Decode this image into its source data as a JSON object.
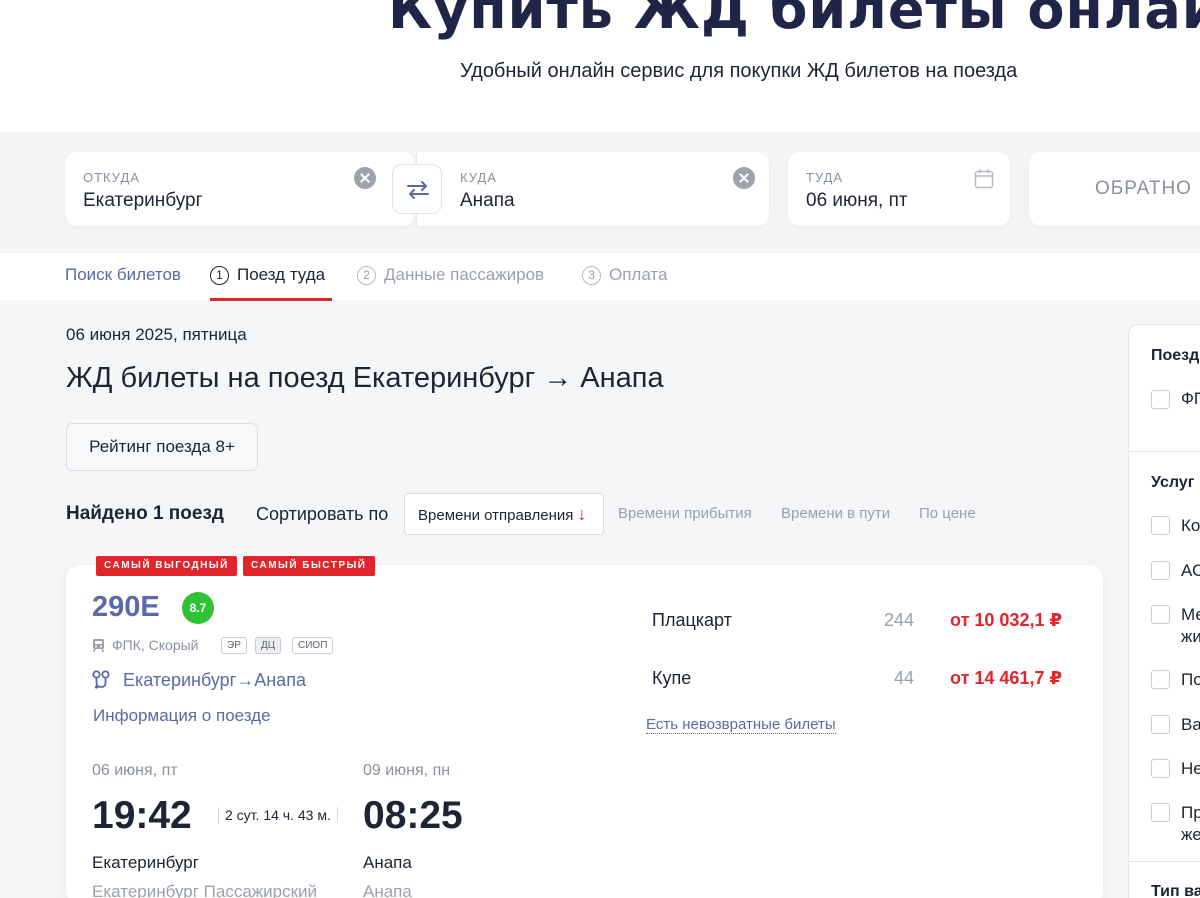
{
  "hero": {
    "title": "Купить ЖД билеты онлайн",
    "subtitle": "Удобный онлайн сервис для покупки ЖД билетов на поезда"
  },
  "search": {
    "from_label": "ОТКУДА",
    "from_value": "Екатеринбург",
    "to_label": "КУДА",
    "to_value": "Анапа",
    "date_label": "ТУДА",
    "date_value": "06 июня, пт",
    "return_label": "ОБРАТНО"
  },
  "steps": {
    "search": "Поиск билетов",
    "items": [
      {
        "num": "1",
        "label": "Поезд туда"
      },
      {
        "num": "2",
        "label": "Данные пассажиров"
      },
      {
        "num": "3",
        "label": "Оплата"
      }
    ]
  },
  "main": {
    "date": "06 июня 2025, пятница",
    "title": "ЖД билеты на поезд Екатеринбург → Анапа",
    "rating_filter": "Рейтинг поезда 8+",
    "found": "Найдено 1 поезд",
    "sort_label": "Сортировать по",
    "sort_active": "Времени отправления",
    "sort_options": [
      "Времени прибытия",
      "Времени в пути",
      "По цене"
    ]
  },
  "train": {
    "badges": [
      "САМЫЙ ВЫГОДНЫЙ",
      "САМЫЙ БЫСТРЫЙ"
    ],
    "number": "290Е",
    "rating": "8.7",
    "carrier": "ФПК, Скорый",
    "tags": [
      "ЭР",
      "ДЦ",
      "СИОП"
    ],
    "route": "Екатеринбург→Анапа",
    "info_link": "Информация о поезде",
    "departure": {
      "date": "06 июня, пт",
      "time": "19:42",
      "city": "Екатеринбург",
      "station": "Екатеринбург Пассажирский"
    },
    "arrival": {
      "date": "09 июня, пн",
      "time": "08:25",
      "city": "Анапа",
      "station": "Анапа"
    },
    "duration": "2 сут. 14 ч. 43 м.",
    "classes": [
      {
        "name": "Плацкарт",
        "seats": "244",
        "price": "от 10 032,1 ₽"
      },
      {
        "name": "Купе",
        "seats": "44",
        "price": "от 14 461,7 ₽"
      }
    ],
    "nonrefundable": "Есть невозвратные билеты"
  },
  "filters": {
    "section1_title": "Поезд",
    "section1_items": [
      "ФП"
    ],
    "section2_title": "Услуг",
    "section2_items": [
      "Ко",
      "АС",
      "Ме",
      "По",
      "Ва",
      "Не",
      "Пр"
    ],
    "section2_item2_lines": [
      "жи",
      "же"
    ],
    "section3_title": "Тип ва"
  },
  "colors": {
    "accent_red": "#e0262c",
    "link_blue": "#5a6aa6",
    "rating_green": "#2ec234",
    "title_navy": "#1f2547"
  }
}
